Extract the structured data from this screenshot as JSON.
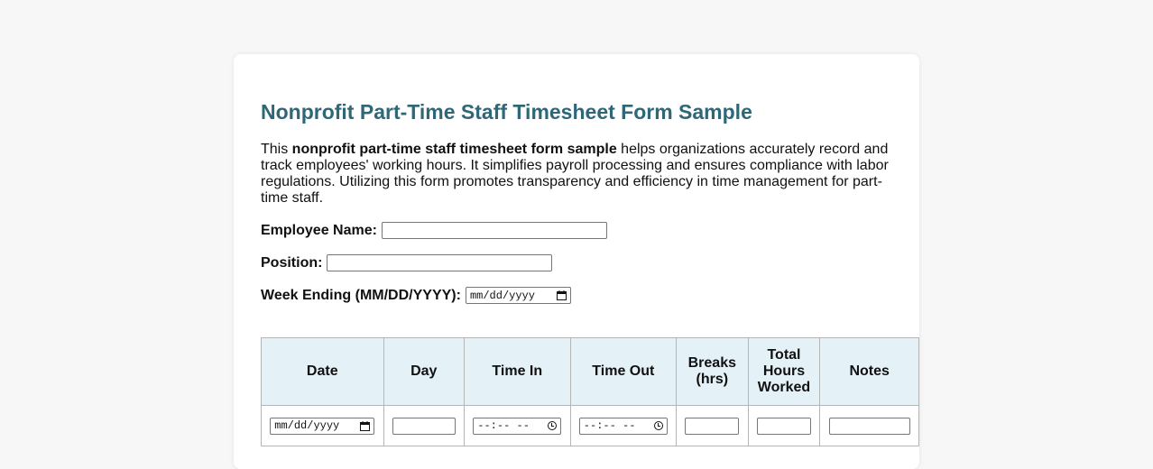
{
  "form": {
    "title": "Nonprofit Part-Time Staff Timesheet Form Sample",
    "intro": {
      "prefix": "This ",
      "bold": "nonprofit part-time staff timesheet form sample",
      "suffix": " helps organizations accurately record and track employees' working hours. It simplifies payroll processing and ensures compliance with labor regulations. Utilizing this form promotes transparency and efficiency in time management for part-time staff."
    },
    "fields": {
      "employee_name_label": "Employee Name:",
      "employee_name_value": "",
      "position_label": "Position:",
      "position_value": "",
      "week_ending_label": "Week Ending (MM/DD/YYYY):",
      "week_ending_placeholder": "mm/dd/yyyy"
    }
  },
  "table": {
    "headers": {
      "date": "Date",
      "day": "Day",
      "time_in": "Time In",
      "time_out": "Time Out",
      "breaks": "Breaks (hrs)",
      "total": "Total Hours Worked",
      "notes": "Notes"
    },
    "row": {
      "date_placeholder": "mm/dd/yyyy",
      "time_in_placeholder": "--:-- --",
      "time_out_placeholder": "--:-- --"
    }
  },
  "icons": {
    "calendar": "calendar-icon",
    "clock": "clock-icon"
  },
  "colors": {
    "title": "#2e6777",
    "header_bg": "#e4f1f7",
    "page_bg": "#f7f7f7"
  }
}
